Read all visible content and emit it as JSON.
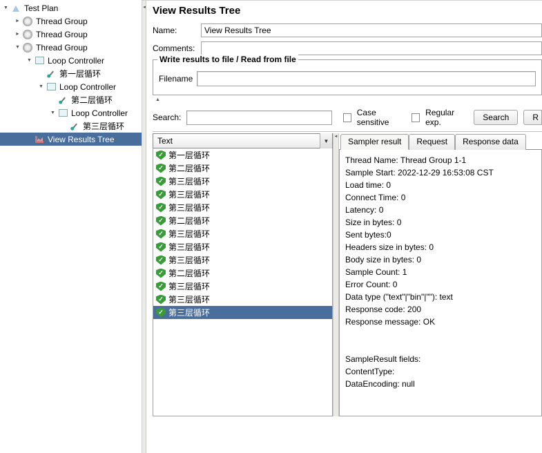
{
  "tree": [
    {
      "indent": 0,
      "handle": "down",
      "icon": "flask",
      "label": "Test Plan"
    },
    {
      "indent": 1,
      "handle": "right",
      "icon": "gear",
      "label": "Thread Group"
    },
    {
      "indent": 1,
      "handle": "right",
      "icon": "gear",
      "label": "Thread Group"
    },
    {
      "indent": 1,
      "handle": "down",
      "icon": "gear",
      "label": "Thread Group"
    },
    {
      "indent": 2,
      "handle": "down",
      "icon": "loop",
      "label": "Loop Controller"
    },
    {
      "indent": 3,
      "handle": "none",
      "icon": "dropper",
      "label": "第一层循环"
    },
    {
      "indent": 3,
      "handle": "down",
      "icon": "loop",
      "label": "Loop Controller"
    },
    {
      "indent": 4,
      "handle": "none",
      "icon": "dropper",
      "label": "第二层循环"
    },
    {
      "indent": 4,
      "handle": "down",
      "icon": "loop",
      "label": "Loop Controller"
    },
    {
      "indent": 5,
      "handle": "none",
      "icon": "dropper",
      "label": "第三层循环"
    },
    {
      "indent": 2,
      "handle": "none",
      "icon": "chart",
      "label": "View Results Tree",
      "selected": true
    }
  ],
  "title": "View Results Tree",
  "form": {
    "name_label": "Name:",
    "name_value": "View Results Tree",
    "comments_label": "Comments:",
    "comments_value": ""
  },
  "file_group": "Write results to file / Read from file",
  "filename_label": "Filename",
  "search": {
    "label": "Search:",
    "case_label": "Case sensitive",
    "regex_label": "Regular exp.",
    "button": "Search"
  },
  "combo_value": "Text",
  "results": [
    "第一层循环",
    "第二层循环",
    "第三层循环",
    "第三层循环",
    "第三层循环",
    "第二层循环",
    "第三层循环",
    "第三层循环",
    "第三层循环",
    "第二层循环",
    "第三层循环",
    "第三层循环",
    "第三层循环"
  ],
  "results_selected_index": 12,
  "tabs": {
    "sampler": "Sampler result",
    "request": "Request",
    "response": "Response data"
  },
  "detail": {
    "lines": [
      "Thread Name: Thread Group 1-1",
      "Sample Start: 2022-12-29 16:53:08 CST",
      "Load time: 0",
      "Connect Time: 0",
      "Latency: 0",
      "Size in bytes: 0",
      "Sent bytes:0",
      "Headers size in bytes: 0",
      "Body size in bytes: 0",
      "Sample Count: 1",
      "Error Count: 0",
      "Data type (\"text\"|\"bin\"|\"\"): text",
      "Response code: 200",
      "Response message: OK",
      "",
      "",
      "SampleResult fields:",
      "ContentType:",
      "DataEncoding: null"
    ]
  }
}
